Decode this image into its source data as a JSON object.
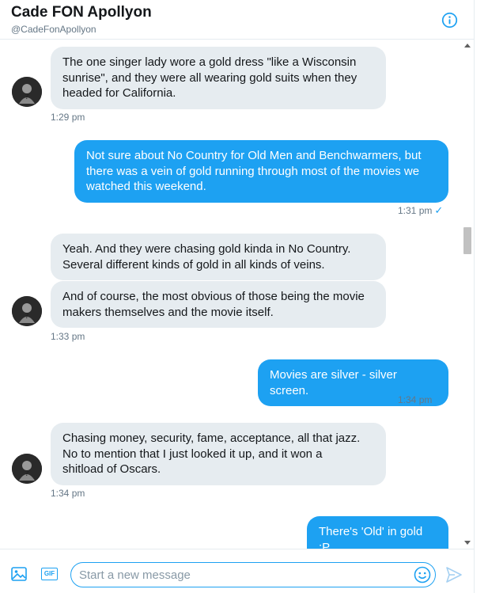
{
  "header": {
    "name": "Cade FON Apollyon",
    "handle": "@CadeFonApollyon",
    "info_icon": "info-icon"
  },
  "messages": [
    {
      "direction": "in",
      "lines": [
        "The one singer lady wore a gold dress \"like a Wisconsin",
        "sunrise\", and they were all wearing gold suits when they",
        "headed for California."
      ]
    },
    {
      "direction": "in_time",
      "time": "1:29 pm"
    },
    {
      "direction": "out",
      "lines": [
        "Not sure about No Country for Old Men and Benchwarmers, but",
        "there was a vein of gold running through most of the movies we",
        "watched this weekend."
      ]
    },
    {
      "direction": "out_time",
      "time": "1:31 pm"
    },
    {
      "direction": "in",
      "lines": [
        "Yeah. And they were chasing gold kinda in No Country.",
        "Several different kinds of gold in all kinds of veins."
      ]
    },
    {
      "direction": "in",
      "lines": [
        "And of course, the most obvious of those being the movie",
        "makers themselves and the movie itself."
      ]
    },
    {
      "direction": "in_time",
      "time": "1:33 pm"
    },
    {
      "direction": "out",
      "lines": [
        "Movies are silver - silver screen."
      ]
    },
    {
      "direction": "out_time",
      "time": "1:34 pm"
    },
    {
      "direction": "in",
      "lines": [
        "Chasing money, security, fame, acceptance, all that jazz.",
        "No to  mention that I just looked it up, and it won a",
        "shitload of Oscars."
      ]
    },
    {
      "direction": "in_time",
      "time": "1:34 pm"
    },
    {
      "direction": "out",
      "lines": [
        "There's 'Old' in gold ;P"
      ]
    }
  ],
  "composer": {
    "placeholder": "Start a new message",
    "value": "",
    "media_icon": "image-icon",
    "gif_label": "GIF",
    "emoji_icon": "emoji-icon",
    "send_icon": "send-icon"
  },
  "colors": {
    "accent": "#1da1f2",
    "incoming_bubble": "#e6ecf0",
    "text": "#14171a",
    "muted": "#657786"
  }
}
